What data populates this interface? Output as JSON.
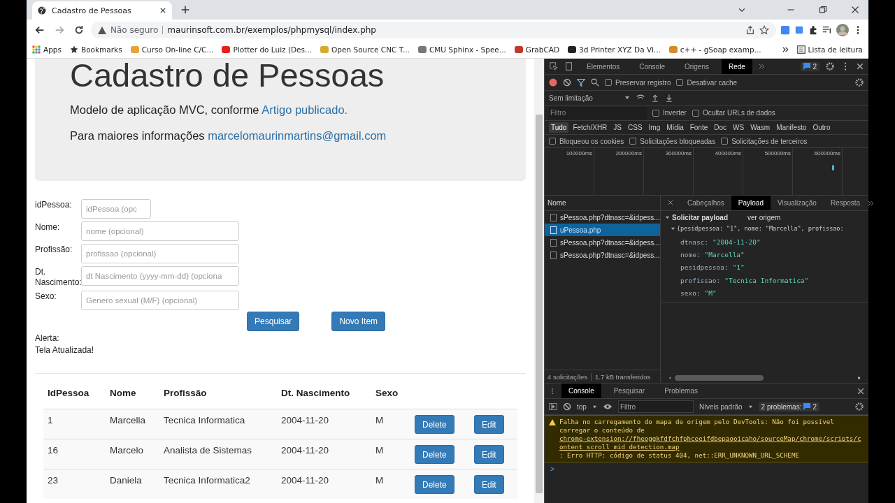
{
  "browser": {
    "tab_title": "Cadastro de Pessoas",
    "security": "Não seguro",
    "url": "maurinsoft.com.br/exemplos/phpmysql/index.php",
    "bookmarks": [
      {
        "kind": "apps",
        "label": "Apps"
      },
      {
        "kind": "star",
        "label": "Bookmarks"
      },
      {
        "kind": "site",
        "label": "Curso On-line C/C...",
        "color": "#e8a23a"
      },
      {
        "kind": "site",
        "label": "Plotter do Luiz (Des...",
        "color": "#e62117"
      },
      {
        "kind": "site",
        "label": "Open Source CNC T...",
        "color": "#d9a92b"
      },
      {
        "kind": "site",
        "label": "CMU Sphinx - Spee...",
        "color": "#777777"
      },
      {
        "kind": "site",
        "label": "GrabCAD",
        "color": "#c0392b"
      },
      {
        "kind": "site",
        "label": "3d Printer XYZ Da Vi...",
        "color": "#222222"
      },
      {
        "kind": "site",
        "label": "c++ - gSoap examp...",
        "color": "#d58b2a"
      }
    ],
    "reading_list": "Lista de leitura"
  },
  "page": {
    "title": "Cadastro de Pessoas",
    "intro": {
      "text": "Modelo de aplicação MVC, conforme ",
      "link": "Artigo publicado."
    },
    "contact": {
      "text": "Para maiores informações ",
      "link": "marcelomaurinmartins@gmail.com"
    },
    "fields": [
      {
        "label": "idPessoa:",
        "placeholder": "idPessoa (opc",
        "kind": "short"
      },
      {
        "label": "Nome:",
        "placeholder": "nome (opcional)",
        "kind": "wide"
      },
      {
        "label": "Profissão:",
        "placeholder": "profissao (opcional)",
        "kind": "wide"
      },
      {
        "label": "Dt. Nascimento:",
        "placeholder": "dt Nascimento (yyyy-mm-dd) (opciona",
        "kind": "wide"
      },
      {
        "label": "Sexo:",
        "placeholder": "Genero sexual (M/F) (opcional)",
        "kind": "wide"
      }
    ],
    "buttons": [
      "Pesquisar",
      "Novo Item"
    ],
    "alert_label": "Alerta:",
    "alert_message": "Tela Atualizada!",
    "table": {
      "columns": [
        "IdPessoa",
        "Nome",
        "Profissão",
        "Dt. Nascimento",
        "Sexo"
      ],
      "rows": [
        {
          "cells": [
            "1",
            "Marcella",
            "Tecnica Informatica",
            "2004-11-20",
            "M"
          ],
          "actions": [
            "Delete",
            "Edit"
          ]
        },
        {
          "cells": [
            "16",
            "Marcelo",
            "Analista de Sistemas",
            "2004-11-20",
            "M"
          ],
          "actions": [
            "Delete",
            "Edit"
          ]
        },
        {
          "cells": [
            "23",
            "Daniela",
            "Tecnica Informatica2",
            "2004-11-20",
            "M"
          ],
          "actions": [
            "Delete",
            "Edit"
          ]
        }
      ]
    }
  },
  "devtools": {
    "tabs": [
      {
        "label": "Elementos",
        "selected": false
      },
      {
        "label": "Console",
        "selected": false
      },
      {
        "label": "Origens",
        "selected": false
      },
      {
        "label": "Rede",
        "selected": true
      }
    ],
    "issues_badge": "2",
    "recording": true,
    "preserve_log": {
      "label": "Preservar registro",
      "checked": false
    },
    "disable_cache": {
      "label": "Desativar cache",
      "checked": false
    },
    "throttling": "Sem limitação",
    "filter_placeholder": "Filtro",
    "invert": {
      "label": "Inverter",
      "checked": false
    },
    "hide_data_urls": {
      "label": "Ocultar URLs de dados",
      "checked": false
    },
    "type_filters": [
      {
        "label": "Tudo",
        "selected": true
      },
      {
        "label": "Fetch/XHR",
        "selected": false
      },
      {
        "label": "JS",
        "selected": false
      },
      {
        "label": "CSS",
        "selected": false
      },
      {
        "label": "Img",
        "selected": false
      },
      {
        "label": "Mídia",
        "selected": false
      },
      {
        "label": "Fonte",
        "selected": false
      },
      {
        "label": "Doc",
        "selected": false
      },
      {
        "label": "WS",
        "selected": false
      },
      {
        "label": "Wasm",
        "selected": false
      },
      {
        "label": "Manifesto",
        "selected": false
      },
      {
        "label": "Outro",
        "selected": false
      }
    ],
    "extra_filters": [
      {
        "label": "Bloqueou os cookies",
        "checked": false
      },
      {
        "label": "Solicitações bloqueadas",
        "checked": false
      },
      {
        "label": "Solicitações de terceiros",
        "checked": false
      }
    ],
    "timeline_ticks": [
      "100000ms",
      "200000ms",
      "300000ms",
      "400000ms",
      "500000ms",
      "600000ms"
    ],
    "requests_header": "Nome",
    "requests": [
      {
        "name": "sPessoa.php?dtnasc=&idpess...",
        "selected": false
      },
      {
        "name": "uPessoa.php",
        "selected": true
      },
      {
        "name": "sPessoa.php?dtnasc=&idpess...",
        "selected": false
      },
      {
        "name": "sPessoa.php?dtnasc=&idpess...",
        "selected": false
      }
    ],
    "detail_tabs": [
      {
        "label": "Cabeçalhos",
        "selected": false
      },
      {
        "label": "Payload",
        "selected": true
      },
      {
        "label": "Visualização",
        "selected": false
      },
      {
        "label": "Resposta",
        "selected": false
      }
    ],
    "payload": {
      "title": "Solicitar payload",
      "view_source": "ver origem",
      "summary": "{pesidpessoa: \"1\", nome: \"Marcella\", profissao:",
      "entries": [
        {
          "key": "dtnasc:",
          "value": "\"2004-11-20\""
        },
        {
          "key": "nome:",
          "value": "\"Marcella\""
        },
        {
          "key": "pesidpessoa:",
          "value": "\"1\""
        },
        {
          "key": "profissao:",
          "value": "\"Tecnica Informatica\""
        },
        {
          "key": "sexo:",
          "value": "\"M\""
        }
      ]
    },
    "status": [
      "4 solicitações",
      "1.7 kB transferidos"
    ],
    "drawer_tabs": [
      {
        "label": "Console",
        "selected": true
      },
      {
        "label": "Pesquisar",
        "selected": false
      },
      {
        "label": "Problemas",
        "selected": false
      }
    ],
    "context": "top",
    "console_filter_placeholder": "Filtro",
    "levels": "Níveis padrão",
    "problems_label": "2 problemas:",
    "problems_count": "2",
    "warning": {
      "text_before": "Falha no carregamento do mapa de origem pelo DevTools: Não foi possível carregar o conteúdo de ",
      "link": "chrome-extension://fheoggkfdfchfphceeifdbepaooicaho/sourceMap/chrome/scripts/content_scroll_mid_detection.map",
      "text_after": ": Erro HTTP: código de status 404, net::ERR_UNKNOWN_URL_SCHEME"
    },
    "prompt": ">"
  }
}
